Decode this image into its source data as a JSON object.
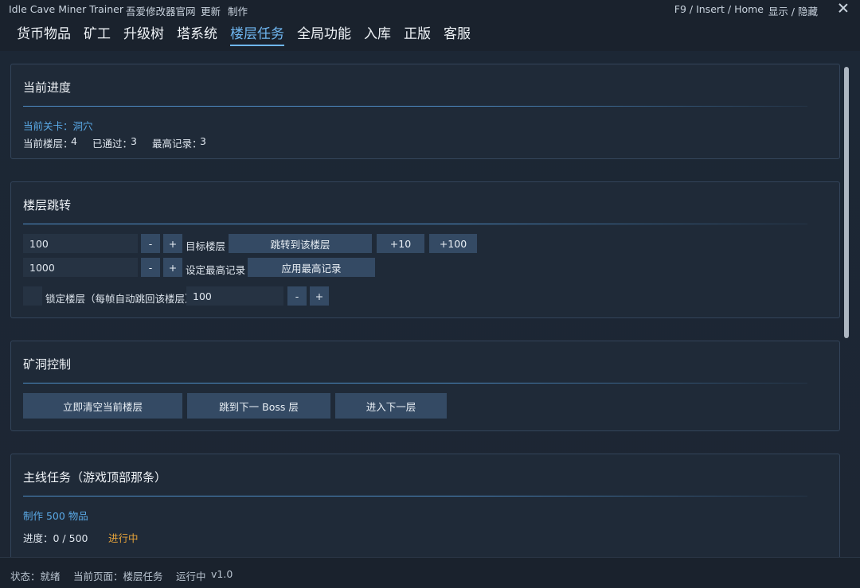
{
  "titlebar": {
    "app_title": "Idle Cave Miner Trainer",
    "links": [
      "吾爱修改器官网",
      "更新",
      "制作"
    ],
    "hotkey": "F9 / Insert / Home",
    "toggle": "显示 / 隐藏"
  },
  "tabs": [
    "货币物品",
    "矿工",
    "升级树",
    "塔系统",
    "楼层任务",
    "全局功能",
    "入库",
    "正版",
    "客服"
  ],
  "active_tab": "楼层任务",
  "progress": {
    "title": "当前进度",
    "current_level": "当前关卡：洞穴",
    "current_floor_label": "当前楼层：",
    "current_floor": "4",
    "passed_label": "已通过：",
    "passed": "3",
    "record_label": "最高记录：",
    "record": "3"
  },
  "floor_jump": {
    "title": "楼层跳转",
    "target_value": "100",
    "minus": "-",
    "plus": "+",
    "target_label": "目标楼层",
    "jump_button": "跳转到该楼层",
    "plus10": "+10",
    "plus100": "+100",
    "record_value": "1000",
    "record_label": "设定最高记录",
    "apply_record_button": "应用最高记录",
    "lock_label": "锁定楼层（每帧自动跳回该楼层）",
    "lock_value": "100"
  },
  "cave_control": {
    "title": "矿洞控制",
    "clear_button": "立即清空当前楼层",
    "boss_button": "跳到下一 Boss 层",
    "next_button": "进入下一层"
  },
  "main_quest": {
    "title": "主线任务（游戏顶部那条）",
    "task": "制作 500 物品",
    "progress": "进度：0 / 500",
    "status": "进行中"
  },
  "statusbar": {
    "status": "状态：就绪",
    "page": "当前页面：楼层任务",
    "running": "运行中",
    "version": "v1.0"
  }
}
